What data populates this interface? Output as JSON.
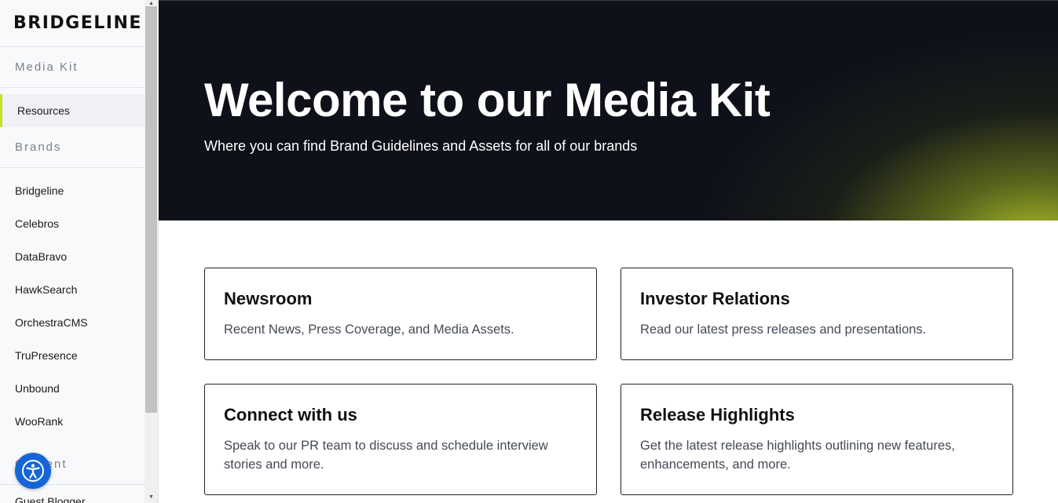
{
  "sidebar": {
    "logo": "BRIDGELINE",
    "sections": [
      {
        "title": "Media Kit",
        "items": [
          {
            "label": "Resources",
            "active": true
          }
        ]
      },
      {
        "title": "Brands",
        "items": [
          {
            "label": "Bridgeline"
          },
          {
            "label": "Celebros"
          },
          {
            "label": "DataBravo"
          },
          {
            "label": "HawkSearch"
          },
          {
            "label": "OrchestraCMS"
          },
          {
            "label": "TruPresence"
          },
          {
            "label": "Unbound"
          },
          {
            "label": "WooRank"
          }
        ]
      },
      {
        "title": "Content",
        "items": [
          {
            "label": "Guest Blogger"
          }
        ]
      }
    ],
    "accessibility_icon": "accessibility-person-icon"
  },
  "hero": {
    "title": "Welcome to our Media Kit",
    "subtitle": "Where you can find Brand Guidelines and Assets for all of our brands"
  },
  "cards": [
    {
      "title": "Newsroom",
      "description": "Recent News, Press Coverage, and Media Assets."
    },
    {
      "title": "Investor Relations",
      "description": "Read our latest press releases and presentations."
    },
    {
      "title": "Connect with us",
      "description": "Speak to our PR team to discuss and schedule interview stories and more."
    },
    {
      "title": "Release Highlights",
      "description": "Get the latest release highlights outlining new features, enhancements, and more."
    }
  ],
  "colors": {
    "accent": "#c7e02a",
    "hero_bg": "#0f111a",
    "a11y_button": "#1565d8"
  }
}
